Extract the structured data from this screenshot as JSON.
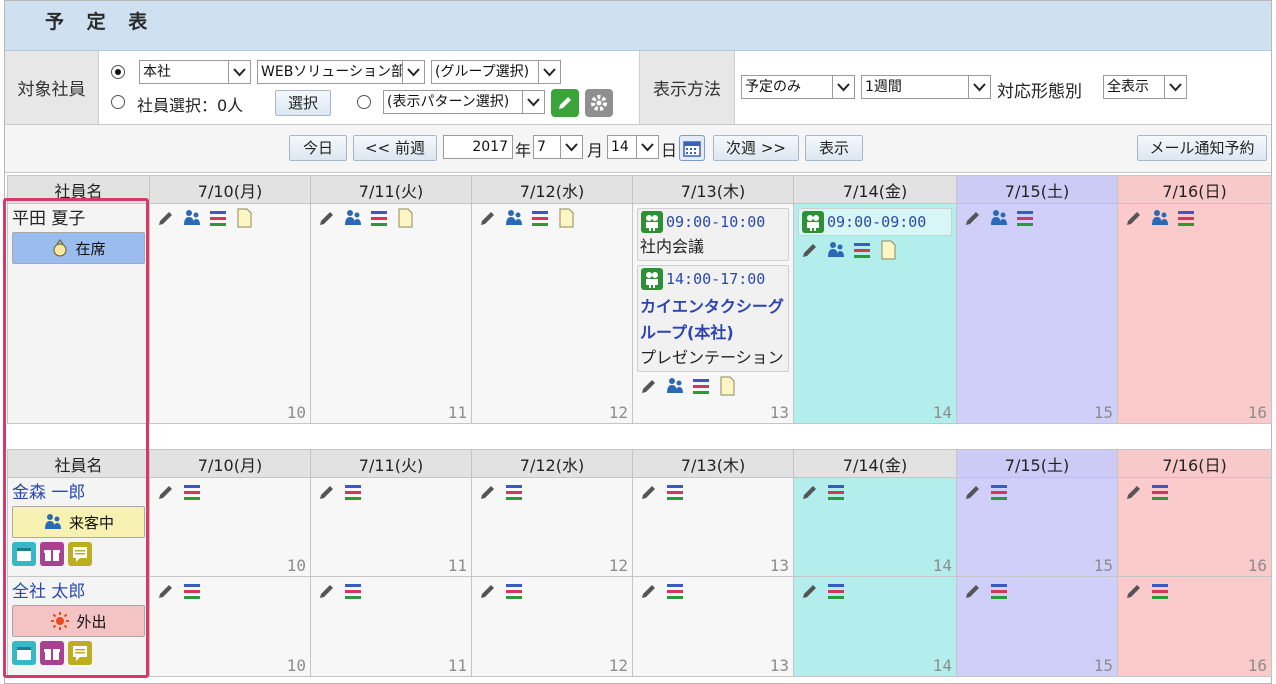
{
  "title": "予 定 表",
  "filters": {
    "target_label": "対象社員",
    "company_select": "本社",
    "dept_select": "WEBソリューション部",
    "group_select": "(グループ選択)",
    "employee_select_text": "社員選択：0人",
    "select_button": "選択",
    "pattern_select": "(表示パターン選択)",
    "display_label": "表示方法",
    "display_select": "予定のみ",
    "period_select": "1週間",
    "type_label": "対応形態別",
    "type_select": "全表示"
  },
  "nav": {
    "today": "今日",
    "prev_week": "<< 前週",
    "year": "2017",
    "year_unit": "年",
    "month": "7",
    "month_unit": "月",
    "day": "14",
    "day_unit": "日",
    "next_week": "次週 >>",
    "show": "表示",
    "mail_notice": "メール通知予約"
  },
  "table_header": {
    "name_col": "社員名",
    "days": [
      "7/10(月)",
      "7/11(火)",
      "7/12(水)",
      "7/13(木)",
      "7/14(金)",
      "7/15(土)",
      "7/16(日)"
    ],
    "day_numbers": [
      "10",
      "11",
      "12",
      "13",
      "14",
      "15",
      "16"
    ]
  },
  "self": {
    "name": "平田 夏子",
    "status": "在席",
    "events": {
      "thu_1": {
        "time": "09:00-10:00",
        "title": "社内会議"
      },
      "thu_2": {
        "time": "14:00-17:00",
        "group_line1": "カイエンタクシーグ",
        "group_line2": "ループ(本社)",
        "title": "プレゼンテーション"
      },
      "fri_1": {
        "time": "09:00-09:00"
      }
    }
  },
  "employees": [
    {
      "name": "金森 一郎",
      "status": "来客中"
    },
    {
      "name": "全社 太郎",
      "status": "外出"
    }
  ],
  "colors": {
    "highlight": "#d63a6a",
    "friday": "#b3eeed",
    "saturday": "#cfcffa",
    "sunday": "#fbcaca"
  }
}
